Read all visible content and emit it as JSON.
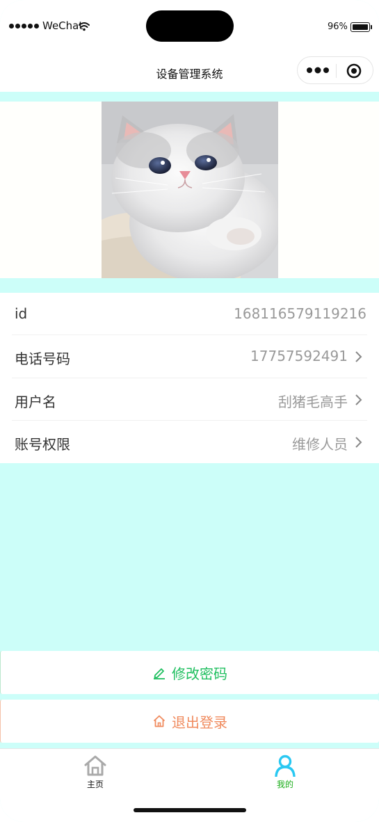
{
  "status_bar": {
    "carrier": "WeChat",
    "battery_percent": "96%",
    "signal_icon": "signal-dots-icon",
    "wifi_icon": "wifi-icon",
    "battery_icon": "battery-icon"
  },
  "nav": {
    "title": "设备管理系统",
    "more_icon": "more-dots-icon",
    "close_icon": "target-close-icon"
  },
  "profile": {
    "avatar_icon": "cat-avatar-image",
    "rows": [
      {
        "label": "id",
        "value": "168116579119216"
      },
      {
        "label": "电话号码",
        "value": "17757592491"
      },
      {
        "label": "用户名",
        "value": "刮猪毛高手"
      },
      {
        "label": "账号权限",
        "value": "维修人员"
      }
    ]
  },
  "actions": {
    "change_password": "修改密码",
    "logout": "退出登录"
  },
  "tab_bar": {
    "home": "主页",
    "mine": "我的"
  },
  "colors": {
    "page_background": "#ccfef9",
    "password_green": "#1fbf5f",
    "logout_orange": "#f08a5d",
    "tab_active_green": "#1aad19",
    "tab_active_icon": "#29c8f2"
  }
}
